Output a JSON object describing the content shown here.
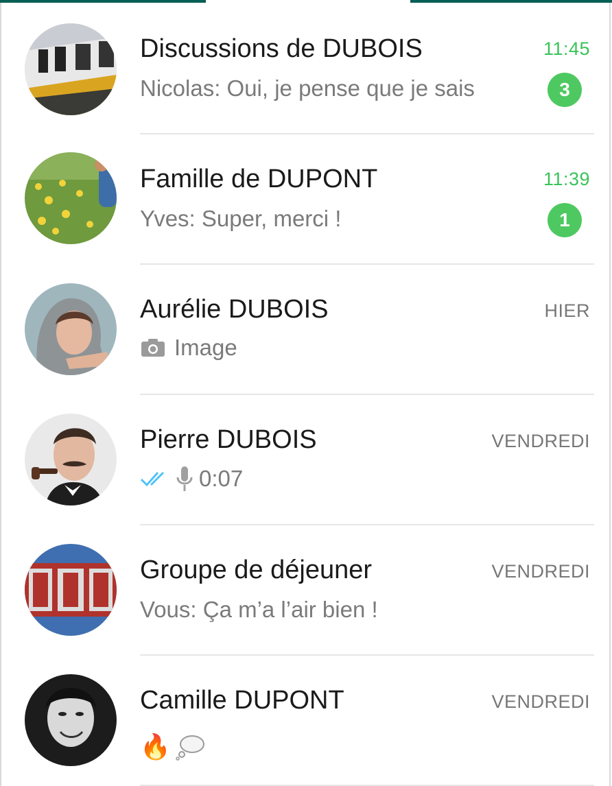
{
  "chats": [
    {
      "name": "Discussions de DUBOIS",
      "time": "11:45",
      "preview": "Nicolas: Oui, je pense que je sais",
      "unread": "3",
      "avatar": "boat-photo"
    },
    {
      "name": "Famille de DUPONT",
      "time": "11:39",
      "preview": "Yves: Super, merci !",
      "unread": "1",
      "avatar": "flowers-child-photo"
    },
    {
      "name": "Aurélie DUBOIS",
      "time": "HIER",
      "preview": "Image",
      "preview_icon": "camera-icon",
      "avatar": "woman-hood-photo"
    },
    {
      "name": "Pierre DUBOIS",
      "time": "VENDREDI",
      "preview": "0:07",
      "preview_icons": [
        "double-check-icon",
        "microphone-icon"
      ],
      "avatar": "man-pipe-photo"
    },
    {
      "name": "Groupe de déjeuner",
      "time": "VENDREDI",
      "preview": "Vous: Ça m’a l’air bien !",
      "avatar": "eat-sign-photo"
    },
    {
      "name": "Camille DUPONT",
      "time": "VENDREDI",
      "preview_emoji": "🔥",
      "preview_icons": [
        "fire-emoji",
        "thought-bubble-icon"
      ],
      "avatar": "woman-portrait-photo"
    }
  ],
  "colors": {
    "accent": "#39c35b",
    "badge": "#4ec961",
    "read_ticks": "#4fc3f7",
    "header": "#075e54"
  }
}
